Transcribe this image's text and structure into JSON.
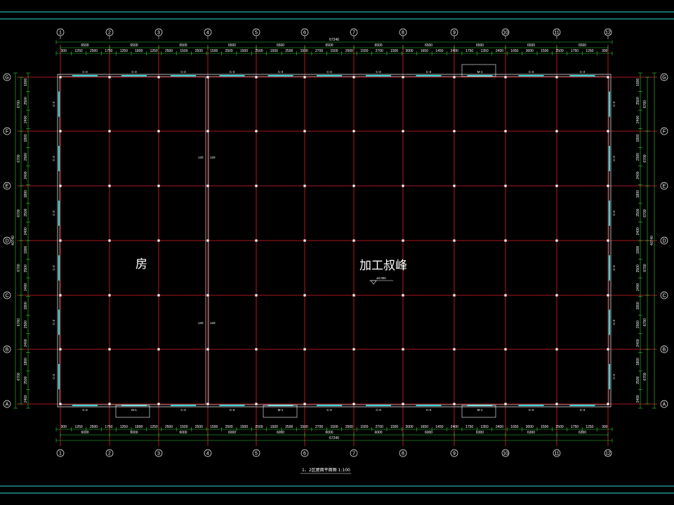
{
  "colors": {
    "background": "#000000",
    "grid_line": "#e0202a",
    "dimension_line": "#33cc33",
    "frame_line": "#39d4d4",
    "wall_line": "#ffffff",
    "text": "#ffffff"
  },
  "top_axes": {
    "labels": [
      "1",
      "2",
      "3",
      "4",
      "5",
      "6",
      "7",
      "8",
      "9",
      "10",
      "11",
      "12"
    ],
    "overall": "67240",
    "spans": [
      "6500",
      "6500",
      "6500",
      "6500",
      "6500",
      "6500",
      "6500",
      "6500",
      "6500",
      "6500",
      "6500"
    ],
    "segments": [
      "300",
      "1250",
      "2500",
      "1750",
      "1250",
      "1800",
      "1250",
      "2500",
      "1500",
      "2500",
      "1500",
      "2500",
      "1500",
      "2500",
      "1500",
      "2500",
      "1500",
      "2700",
      "1500",
      "2500",
      "1500",
      "2700",
      "1500",
      "3000",
      "1650",
      "1450",
      "2400",
      "1750",
      "1350",
      "2400",
      "1650",
      "3000",
      "1500",
      "2500",
      "1750",
      "1250",
      "300"
    ]
  },
  "bottom_axes": {
    "labels": [
      "1",
      "2",
      "3",
      "4",
      "5",
      "6",
      "7",
      "8",
      "9",
      "10",
      "11",
      "12"
    ],
    "overall": "67240",
    "spans": [
      "6000",
      "6000",
      "6000",
      "6000",
      "6000",
      "6000",
      "6000",
      "6000",
      "6300",
      "6300",
      "6300"
    ],
    "segments": [
      "300",
      "1250",
      "2500",
      "1750",
      "1250",
      "1800",
      "1250",
      "2500",
      "1500",
      "2500",
      "1500",
      "2500",
      "1500",
      "2500",
      "1500",
      "2500",
      "1500",
      "2700",
      "1500",
      "2500",
      "1500",
      "2700",
      "1500",
      "3000",
      "1650",
      "1450",
      "2400",
      "1750",
      "1350",
      "2400",
      "1650",
      "3000",
      "1500",
      "2500",
      "1750",
      "1250",
      "300"
    ]
  },
  "left_axes": {
    "labels": [
      "G",
      "F",
      "E",
      "D",
      "C",
      "B",
      "A"
    ],
    "overall": "40740",
    "spans": [
      "6700",
      "6700",
      "6700",
      "6700",
      "6700",
      "6700"
    ],
    "segments": [
      "1800",
      "2500",
      "2400",
      "1800",
      "2500",
      "2400",
      "1800",
      "2500",
      "2400",
      "1800",
      "2500",
      "2400",
      "1800",
      "2500",
      "2400",
      "1800",
      "2500",
      "2400"
    ]
  },
  "right_axes": {
    "labels": [
      "G",
      "F",
      "E",
      "D",
      "C",
      "B",
      "A"
    ],
    "overall": "40740",
    "spans": [
      "6700",
      "6700",
      "6700",
      "6700",
      "6700",
      "6700"
    ],
    "segments": [
      "1800",
      "2500",
      "2400",
      "1800",
      "2500",
      "2400",
      "1800",
      "2500",
      "2400",
      "1800",
      "2500",
      "2400",
      "1800",
      "2500",
      "2400",
      "1800",
      "2500",
      "2400"
    ]
  },
  "openings": {
    "top": [
      "C-3",
      "C-3",
      "C-3",
      "C-3",
      "C-3",
      "C-3",
      "C-3",
      "C-3",
      "M-1",
      "C-3",
      "C-3"
    ],
    "bottom": [
      "C-3",
      "M-1",
      "C-3",
      "C-3",
      "M-1",
      "C-3",
      "C-3",
      "C-3",
      "M-1",
      "C-3",
      "C-3"
    ],
    "left": [
      "C-3",
      "C-3",
      "C-3",
      "C-3",
      "C-3",
      "C-3"
    ],
    "right": [
      "C-3",
      "C-3",
      "C-3",
      "C-3",
      "C-3",
      "C-3"
    ]
  },
  "rooms": {
    "left": "房",
    "main": "加工叔峰"
  },
  "elevation_mark": "±0.000",
  "partition_notes": [
    "120",
    "120",
    "120",
    "120"
  ],
  "caption": "1、2区屋面平面图 1:100"
}
